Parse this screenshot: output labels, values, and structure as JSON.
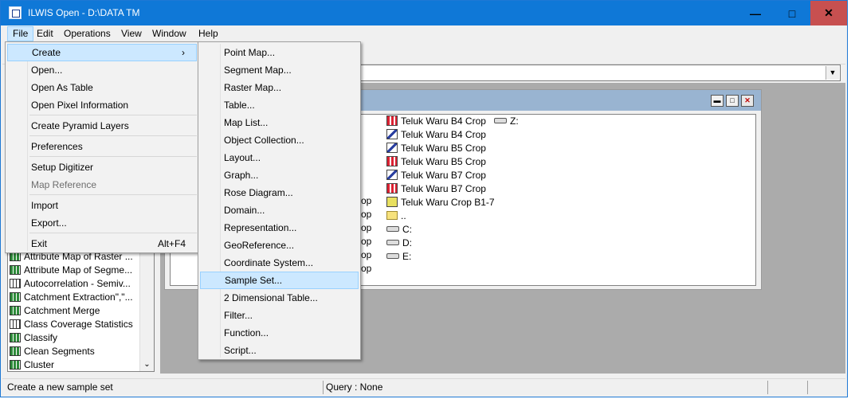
{
  "window": {
    "title": "ILWIS Open - D:\\DATA TM"
  },
  "menubar": {
    "items": [
      "File",
      "Edit",
      "Operations",
      "View",
      "Window",
      "Help"
    ]
  },
  "file_menu": {
    "items": [
      {
        "label": "Create",
        "has_submenu": true
      },
      {
        "label": "Open..."
      },
      {
        "label": "Open As Table"
      },
      {
        "label": "Open Pixel Information"
      },
      {
        "label": "Create Pyramid Layers"
      },
      {
        "label": "Preferences"
      },
      {
        "label": "Setup Digitizer"
      },
      {
        "label": "Map Reference",
        "disabled": true
      },
      {
        "label": "Import"
      },
      {
        "label": "Export..."
      },
      {
        "label": "Exit",
        "shortcut": "Alt+F4"
      }
    ],
    "submenu_arrow": "›"
  },
  "create_submenu": {
    "items": [
      "Point Map...",
      "Segment Map...",
      "Raster Map...",
      "Table...",
      "Map List...",
      "Object Collection...",
      "Layout...",
      "Graph...",
      "Rose Diagram...",
      "Domain...",
      "Representation...",
      "GeoReference...",
      "Coordinate System...",
      "Sample Set...",
      "2 Dimensional Table...",
      "Filter...",
      "Function...",
      "Script..."
    ],
    "highlighted": "Sample Set..."
  },
  "catalog": {
    "col2": [
      {
        "icon": "raster-map-icon",
        "label": "Teluk Waru B4 Crop"
      },
      {
        "icon": "grey-map-icon",
        "label": "Teluk Waru B4 Crop"
      },
      {
        "icon": "grey-map-icon",
        "label": "Teluk Waru B5 Crop"
      },
      {
        "icon": "raster-map-icon",
        "label": "Teluk Waru B5 Crop"
      },
      {
        "icon": "grey-map-icon",
        "label": "Teluk Waru B7 Crop"
      },
      {
        "icon": "raster-map-icon",
        "label": "Teluk Waru B7 Crop"
      },
      {
        "icon": "collection-icon",
        "label": "Teluk Waru Crop B1-7"
      },
      {
        "icon": "folder-icon",
        "label": ".."
      },
      {
        "icon": "drive-icon",
        "label": "C:"
      },
      {
        "icon": "drive-icon",
        "label": "D:"
      },
      {
        "icon": "drive-icon",
        "label": "E:"
      }
    ],
    "col3": [
      {
        "icon": "drive-icon",
        "label": "Z:"
      }
    ],
    "col1_tails": [
      "op",
      "op",
      "op",
      "op",
      "op",
      "op"
    ]
  },
  "operations": {
    "items": [
      "Attribute Map of Raster ...",
      "Attribute Map of Segme...",
      "Autocorrelation - Semiv...",
      "Catchment Extraction\",\"...",
      "Catchment Merge",
      "Class Coverage Statistics",
      "Classify",
      "Clean Segments",
      "Cluster"
    ],
    "scroll_down": "⌄"
  },
  "statusbar": {
    "hint": "Create a new sample set",
    "query": "Query : None"
  },
  "colors": {
    "titlebar": "#0f78d7",
    "highlight": "#cce8ff",
    "close": "#c75050",
    "workspace": "#ababab"
  }
}
